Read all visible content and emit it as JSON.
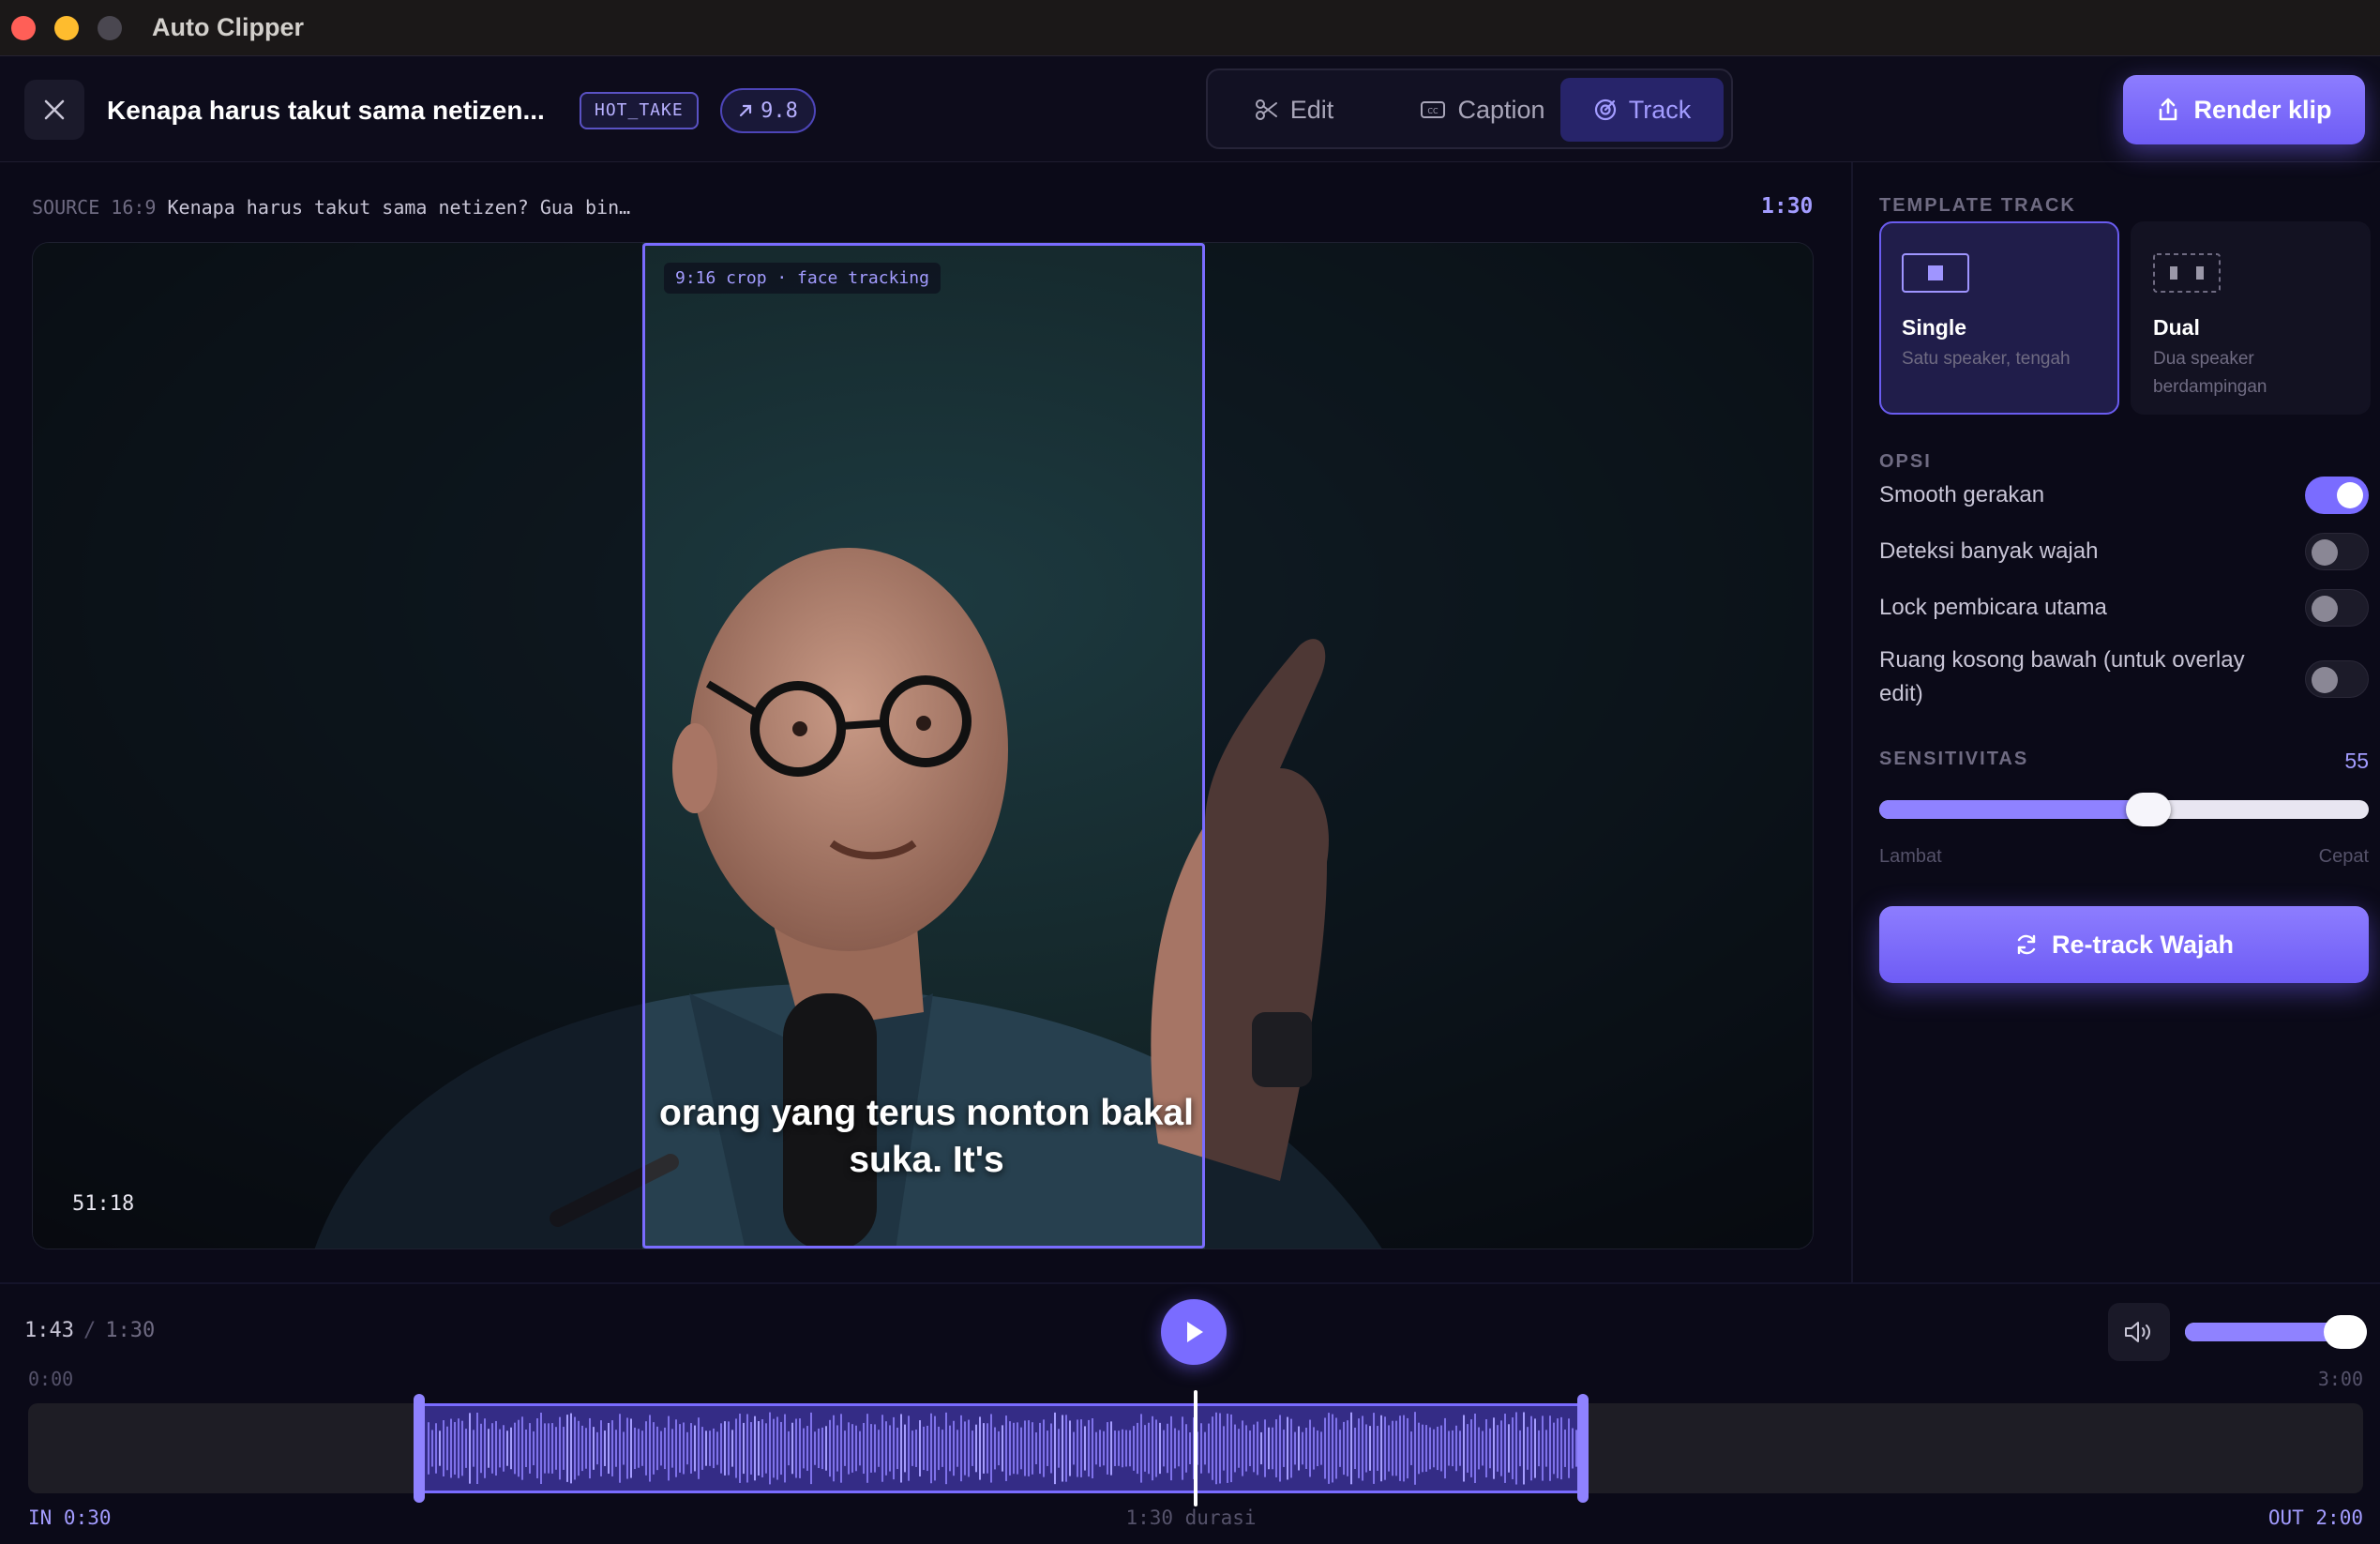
{
  "app": {
    "title": "Auto Clipper"
  },
  "header": {
    "clip_title": "Kenapa harus takut sama netizen...",
    "tag": "HOT_TAKE",
    "score": "9.8",
    "tabs": [
      {
        "label": "Edit",
        "icon": "scissors-icon"
      },
      {
        "label": "Caption",
        "icon": "cc-icon"
      },
      {
        "label": "Track",
        "icon": "target-icon",
        "active": true
      }
    ],
    "render_label": "Render klip"
  },
  "preview": {
    "source_prefix": "SOURCE 16:9",
    "source_title": "Kenapa harus takut sama netizen? Gua bin…",
    "duration": "1:30",
    "crop_label": "9:16 crop · face tracking",
    "caption": "orang yang terus nonton bakal suka. It's",
    "timecode": "51:18"
  },
  "sidebar": {
    "template_label": "TEMPLATE TRACK",
    "templates": [
      {
        "title": "Single",
        "desc": "Satu speaker, tengah",
        "selected": true
      },
      {
        "title": "Dual",
        "desc": "Dua speaker berdampingan",
        "selected": false
      }
    ],
    "options_label": "OPSI",
    "options": [
      {
        "label": "Smooth gerakan",
        "on": true
      },
      {
        "label": "Deteksi banyak wajah",
        "on": false
      },
      {
        "label": "Lock pembicara utama",
        "on": false
      },
      {
        "label": "Ruang kosong bawah (untuk overlay edit)",
        "on": false
      }
    ],
    "sensitivity_label": "SENSITIVITAS",
    "sensitivity_value": "55",
    "sensitivity_fraction": 0.55,
    "sensitivity_min": "Lambat",
    "sensitivity_max": "Cepat",
    "retrack_label": "Re-track Wajah"
  },
  "player": {
    "current": "1:43",
    "total": "1:30",
    "volume_fraction": 0.93
  },
  "timeline": {
    "start": "0:00",
    "end": "3:00",
    "in_fraction": 0.1667,
    "out_fraction": 0.6667,
    "playhead_fraction": 0.5,
    "in_label": "IN 0:30",
    "out_label": "OUT 2:00",
    "duration_label": "1:30 durasi"
  },
  "colors": {
    "accent": "#7a6cff",
    "background": "#0b0a18",
    "panel": "#131222"
  }
}
